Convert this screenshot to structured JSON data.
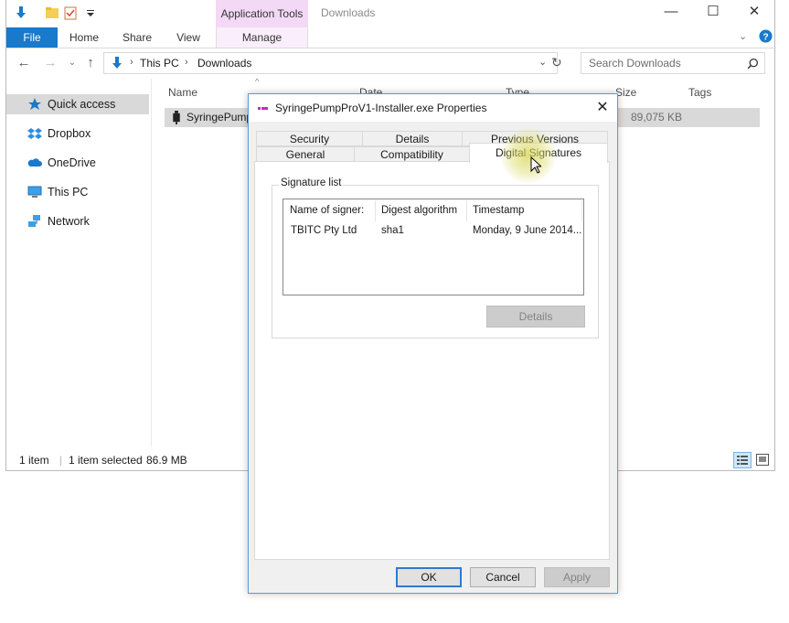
{
  "ribbon": {
    "context_header": "Application Tools",
    "window_title": "Downloads",
    "tabs": [
      "File",
      "Home",
      "Share",
      "View",
      "Manage"
    ]
  },
  "address": {
    "segments": [
      "This PC",
      "Downloads"
    ],
    "search_placeholder": "Search Downloads"
  },
  "nav_pane": {
    "items": [
      {
        "label": "Quick access",
        "icon": "star-icon",
        "selected": true
      },
      {
        "label": "Dropbox",
        "icon": "dropbox-icon"
      },
      {
        "label": "OneDrive",
        "icon": "cloud-icon"
      },
      {
        "label": "This PC",
        "icon": "computer-icon"
      },
      {
        "label": "Network",
        "icon": "network-icon"
      }
    ]
  },
  "file_list": {
    "columns": [
      "Name",
      "Date",
      "Type",
      "Size",
      "Tags"
    ],
    "rows": [
      {
        "name": "SyringePump",
        "size": "89,075 KB"
      }
    ]
  },
  "status_bar": {
    "item_count": "1 item",
    "selection": "1 item selected",
    "size": "86.9 MB"
  },
  "dialog": {
    "title": "SyringePumpProV1-Installer.exe Properties",
    "tabs_back": [
      "Security",
      "Details",
      "Previous Versions"
    ],
    "tabs_front": [
      "General",
      "Compatibility",
      "Digital Signatures"
    ],
    "active_tab": "Digital Signatures",
    "signature_group": "Signature list",
    "list_columns": [
      "Name of signer:",
      "Digest algorithm",
      "Timestamp"
    ],
    "signatures": [
      {
        "signer": "TBITC Pty Ltd",
        "digest": "sha1",
        "timestamp": "Monday, 9 June 2014..."
      }
    ],
    "details_button": "Details",
    "buttons": {
      "ok": "OK",
      "cancel": "Cancel",
      "apply": "Apply"
    }
  },
  "colors": {
    "file_tab": "#1979ca",
    "context_tab": "#f3d9f6",
    "selection": "#cce8ff",
    "dialog_border": "#5c9bd4"
  }
}
